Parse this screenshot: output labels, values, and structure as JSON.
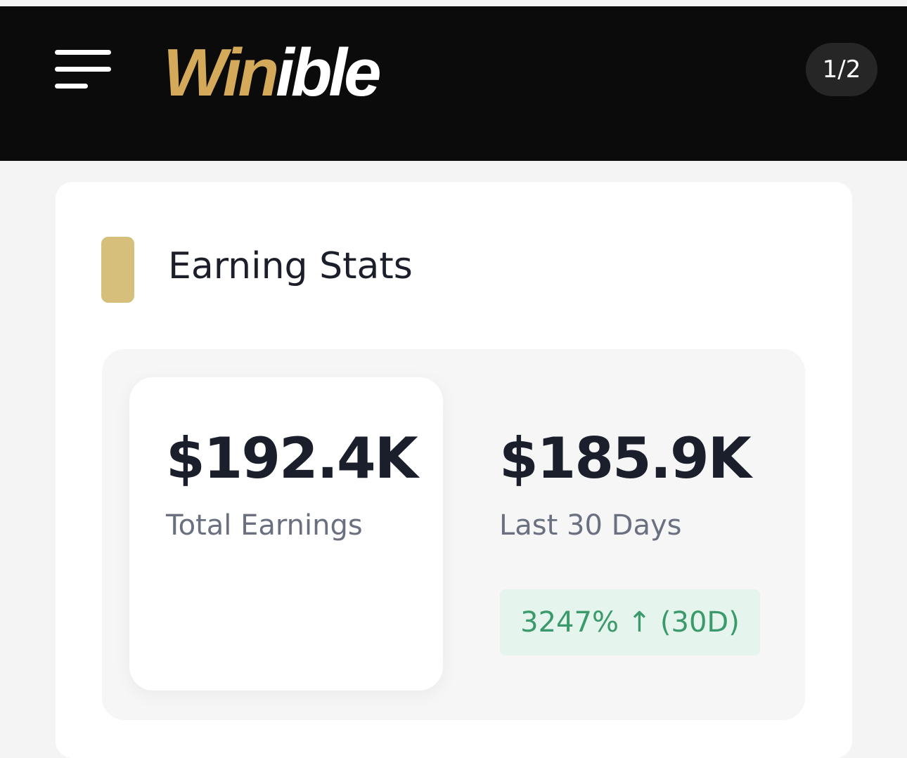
{
  "header": {
    "logo_gold": "Win",
    "logo_white": "ible",
    "page_indicator": "1/2",
    "menu_icon": "hamburger-menu-icon"
  },
  "card": {
    "title": "Earning Stats",
    "stats": [
      {
        "value": "$192.4K",
        "label": "Total Earnings"
      },
      {
        "value": "$185.9K",
        "label": "Last 30 Days"
      }
    ],
    "growth_badge": "3247% ↑ (30D)"
  },
  "colors": {
    "header_bg": "#0b0b0b",
    "brand_gold": "#d4aa5a",
    "accent_gold": "#d6be7b",
    "growth_text": "#3a9a6c",
    "growth_bg": "#e5f4ec"
  }
}
